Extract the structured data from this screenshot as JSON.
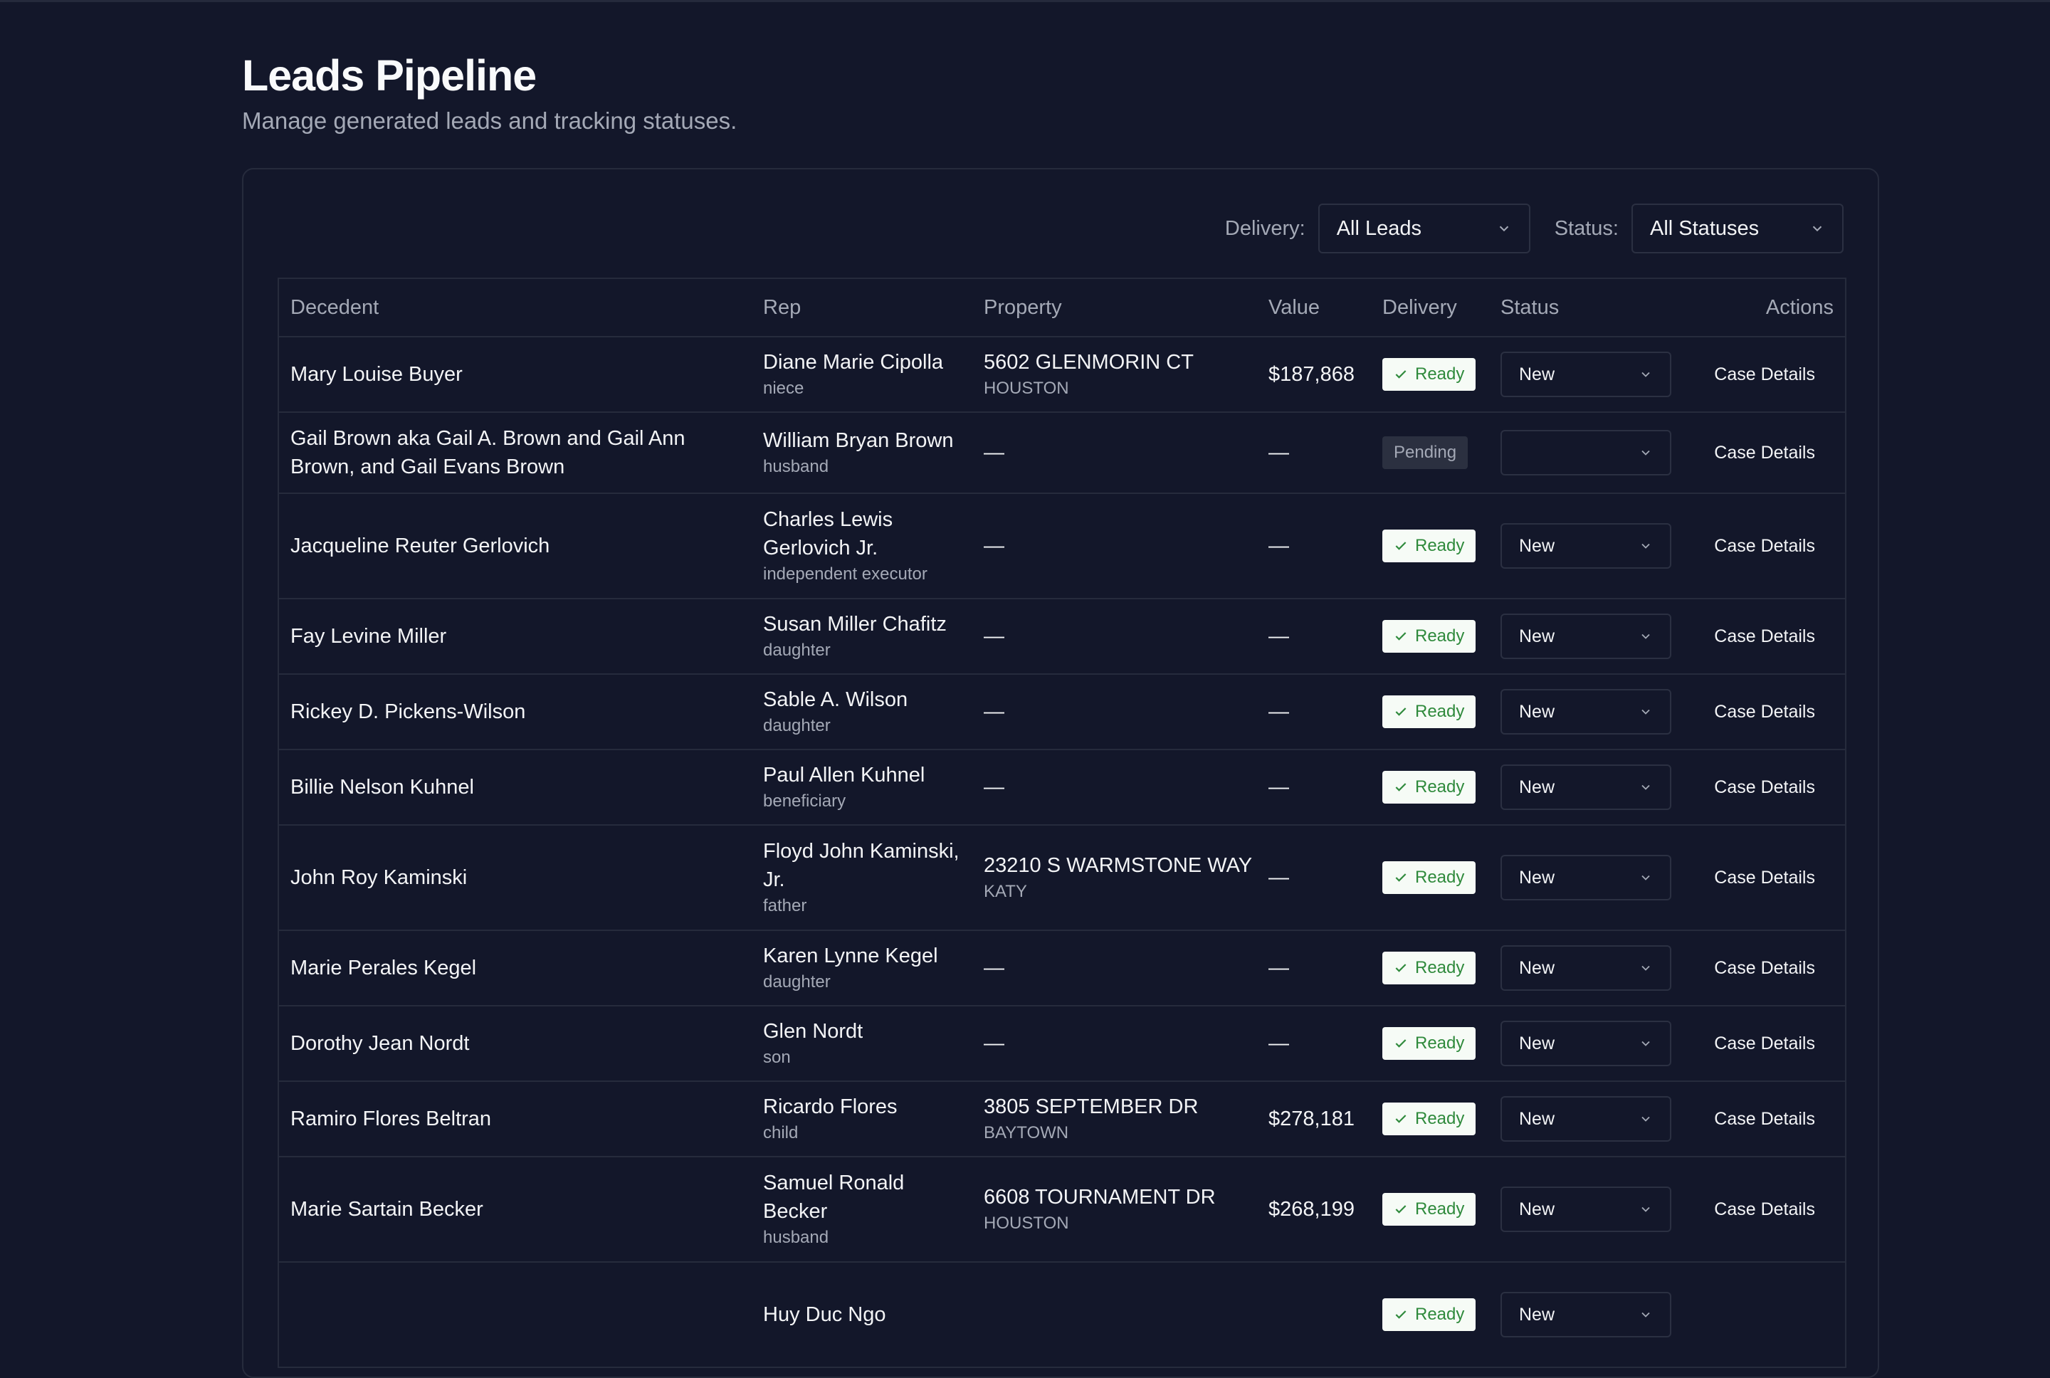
{
  "page": {
    "title": "Leads Pipeline",
    "subtitle": "Manage generated leads and tracking statuses."
  },
  "filters": {
    "delivery_label": "Delivery:",
    "delivery_value": "All Leads",
    "status_label": "Status:",
    "status_value": "All Statuses"
  },
  "table": {
    "columns": [
      "Decedent",
      "Rep",
      "Property",
      "Value",
      "Delivery",
      "Status",
      "Actions"
    ],
    "rows": [
      {
        "decedent": "Mary Louise Buyer",
        "rep_name": "Diane Marie Cipolla",
        "rep_relation": "niece",
        "property_address": "5602 GLENMORIN CT",
        "property_city": "HOUSTON",
        "value": "$187,868",
        "delivery": "Ready",
        "status": "New",
        "action": "Case Details"
      },
      {
        "decedent": "Gail Brown aka Gail A. Brown and Gail Ann Brown, and Gail Evans Brown",
        "rep_name": "William Bryan Brown",
        "rep_relation": "husband",
        "property_address": "—",
        "property_city": "",
        "value": "—",
        "delivery": "Pending",
        "status": "",
        "action": "Case Details"
      },
      {
        "decedent": "Jacqueline Reuter Gerlovich",
        "rep_name": "Charles Lewis Gerlovich Jr.",
        "rep_relation": "independent executor",
        "property_address": "—",
        "property_city": "",
        "value": "—",
        "delivery": "Ready",
        "status": "New",
        "action": "Case Details"
      },
      {
        "decedent": "Fay Levine Miller",
        "rep_name": "Susan Miller Chafitz",
        "rep_relation": "daughter",
        "property_address": "—",
        "property_city": "",
        "value": "—",
        "delivery": "Ready",
        "status": "New",
        "action": "Case Details"
      },
      {
        "decedent": "Rickey D. Pickens-Wilson",
        "rep_name": "Sable A. Wilson",
        "rep_relation": "daughter",
        "property_address": "—",
        "property_city": "",
        "value": "—",
        "delivery": "Ready",
        "status": "New",
        "action": "Case Details"
      },
      {
        "decedent": "Billie Nelson Kuhnel",
        "rep_name": "Paul Allen Kuhnel",
        "rep_relation": "beneficiary",
        "property_address": "—",
        "property_city": "",
        "value": "—",
        "delivery": "Ready",
        "status": "New",
        "action": "Case Details"
      },
      {
        "decedent": "John Roy Kaminski",
        "rep_name": "Floyd John Kaminski, Jr.",
        "rep_relation": "father",
        "property_address": "23210 S WARMSTONE WAY",
        "property_city": "KATY",
        "value": "—",
        "delivery": "Ready",
        "status": "New",
        "action": "Case Details"
      },
      {
        "decedent": "Marie Perales Kegel",
        "rep_name": "Karen Lynne Kegel",
        "rep_relation": "daughter",
        "property_address": "—",
        "property_city": "",
        "value": "—",
        "delivery": "Ready",
        "status": "New",
        "action": "Case Details"
      },
      {
        "decedent": "Dorothy Jean Nordt",
        "rep_name": "Glen Nordt",
        "rep_relation": "son",
        "property_address": "—",
        "property_city": "",
        "value": "—",
        "delivery": "Ready",
        "status": "New",
        "action": "Case Details"
      },
      {
        "decedent": "Ramiro Flores Beltran",
        "rep_name": "Ricardo Flores",
        "rep_relation": "child",
        "property_address": "3805 SEPTEMBER DR",
        "property_city": "BAYTOWN",
        "value": "$278,181",
        "delivery": "Ready",
        "status": "New",
        "action": "Case Details"
      },
      {
        "decedent": "Marie Sartain Becker",
        "rep_name": "Samuel Ronald Becker",
        "rep_relation": "husband",
        "property_address": "6608 TOURNAMENT DR",
        "property_city": "HOUSTON",
        "value": "$268,199",
        "delivery": "Ready",
        "status": "New",
        "action": "Case Details"
      },
      {
        "decedent": "",
        "rep_name": "Huy Duc Ngo",
        "rep_relation": "",
        "property_address": "",
        "property_city": "",
        "value": "",
        "delivery": "Ready",
        "status": "New",
        "action": ""
      }
    ]
  },
  "colors": {
    "background": "#13172a",
    "border": "#262b3c",
    "ready_badge_bg": "#f6fbf6",
    "ready_badge_text": "#2f8a3c",
    "pending_badge_bg": "#2b3040"
  }
}
